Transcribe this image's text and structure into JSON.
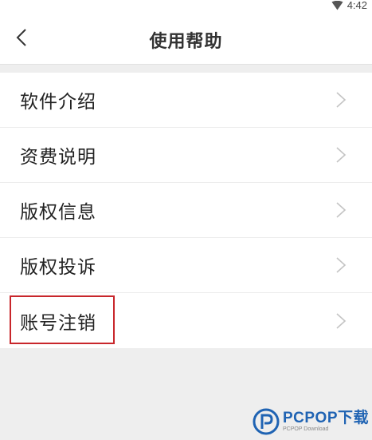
{
  "status_bar": {
    "time": "4:42",
    "icons": [
      "signal-icon"
    ]
  },
  "header": {
    "title": "使用帮助",
    "back_icon": "chevron-left-icon"
  },
  "menu": {
    "items": [
      {
        "label": "软件介绍",
        "icon": "chevron-right-icon"
      },
      {
        "label": "资费说明",
        "icon": "chevron-right-icon"
      },
      {
        "label": "版权信息",
        "icon": "chevron-right-icon"
      },
      {
        "label": "版权投诉",
        "icon": "chevron-right-icon"
      },
      {
        "label": "账号注销",
        "icon": "chevron-right-icon",
        "highlighted": true
      }
    ]
  },
  "annotation": {
    "highlight_color": "#c8262b"
  },
  "watermark": {
    "brand": "PCPOP下载",
    "sub": "PCPOP Download",
    "color": "#1f63b3"
  }
}
